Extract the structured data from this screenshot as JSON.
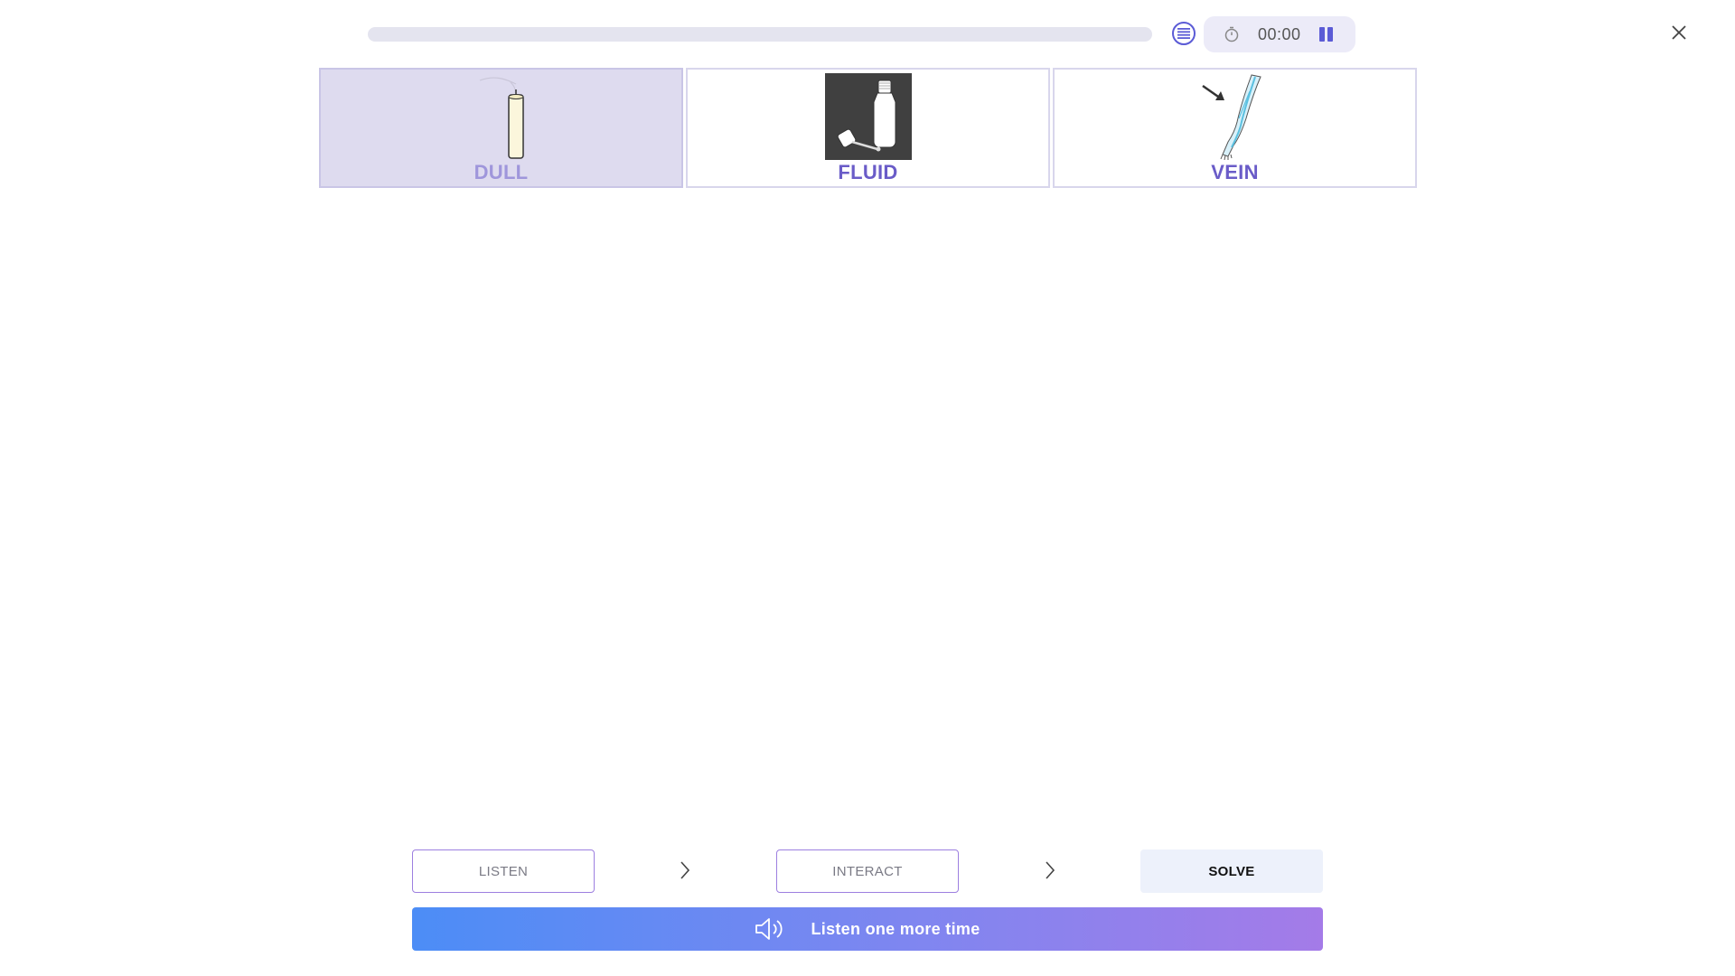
{
  "header": {
    "progress": 0,
    "timer": "00:00",
    "icons": {
      "list": "list-icon",
      "clock": "clock-icon",
      "pause": "pause-icon",
      "close": "close-icon"
    }
  },
  "cards": [
    {
      "label": "DULL",
      "icon": "candle-icon",
      "selected": true
    },
    {
      "label": "FLUID",
      "icon": "bottle-icon",
      "selected": false
    },
    {
      "label": "VEIN",
      "icon": "arm-vein-icon",
      "selected": false
    }
  ],
  "steps": {
    "listen": "LISTEN",
    "interact": "INTERACT",
    "solve": "SOLVE"
  },
  "listen_button": {
    "label": "Listen one more time",
    "icon": "speaker-icon"
  },
  "colors": {
    "accent": "#5b5bd6",
    "card_selected_bg": "#dedbef",
    "label": "#6a5cc8",
    "gradient_start": "#4c8df6",
    "gradient_end": "#a47be8"
  }
}
